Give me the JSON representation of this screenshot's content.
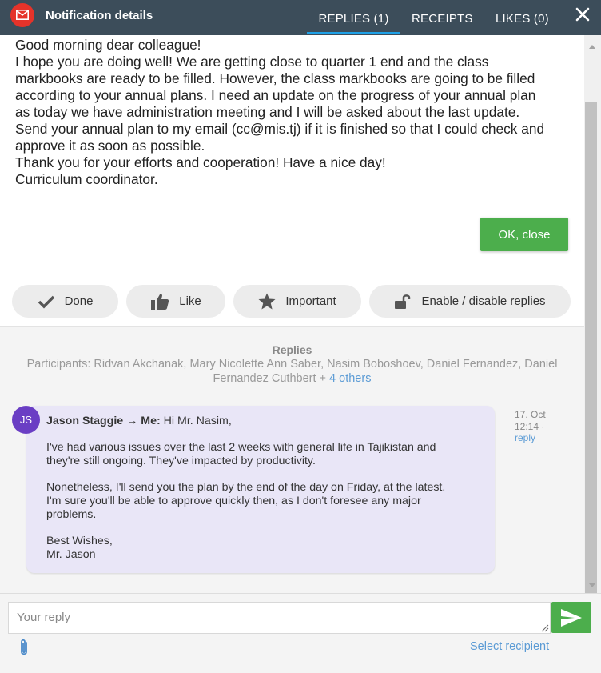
{
  "header": {
    "title": "Notification details",
    "tabs": [
      {
        "label": "REPLIES (1)",
        "active": true
      },
      {
        "label": "RECEIPTS",
        "active": false
      },
      {
        "label": "LIKES (0)",
        "active": false
      }
    ],
    "app_icon": "mail-icon",
    "close_icon": "close-icon"
  },
  "message": {
    "lines": [
      "Good morning dear colleague!",
      "I hope you are doing well! We are getting close to quarter 1 end and the class",
      "markbooks are ready to be filled. However, the class markbooks are going to be filled",
      "according to your annual plans. I need an update on the progress of your annual plan",
      "as today we have administration meeting and I will be asked about the last update.",
      "Send your annual plan to my email (cc@mis.tj) if it is finished so that I could check and",
      "approve it as soon as possible.",
      "Thank you for your efforts and cooperation! Have a nice day!",
      "Curriculum coordinator."
    ],
    "ok_label": "OK, close"
  },
  "actions": [
    {
      "label": "Done",
      "icon": "check-icon"
    },
    {
      "label": "Like",
      "icon": "thumbs-up-icon"
    },
    {
      "label": "Important",
      "icon": "star-icon"
    },
    {
      "label": "Enable / disable replies",
      "icon": "unlock-icon"
    }
  ],
  "replies": {
    "title": "Replies",
    "participants_prefix": "Participants: Ridvan Akchanak, Mary Nicolette Ann Saber, Nasim Boboshoev, Daniel Fernandez, Daniel",
    "participants_line2": "Fernandez Cuthbert +",
    "others_link": "4 others",
    "items": [
      {
        "avatar_initials": "JS",
        "header": "Jason Staggie → Me:",
        "greeting": "Hi Mr. Nasim,",
        "body_lines_1": [
          "I've had various issues over the last 2 weeks with general life in Tajikistan and",
          "they're still ongoing. They've impacted by productivity."
        ],
        "body_lines_2": [
          "Nonetheless, I'll send you the plan by the end of the day on Friday, at the latest.",
          "I'm sure you'll be able to approve quickly then, as I don't foresee any major",
          "problems."
        ],
        "signoff_lines": [
          "Best Wishes,",
          "Mr. Jason"
        ],
        "date": "17. Oct",
        "time": "12:14 ·",
        "reply_label": "reply"
      }
    ]
  },
  "composer": {
    "placeholder": "Your reply",
    "select_recipient": "Select recipient",
    "send_icon": "send-icon",
    "attach_icon": "paperclip-icon"
  },
  "colors": {
    "header_bg": "#3c4d5a",
    "accent": "#1ea0e6",
    "green": "#4cae4c",
    "avatar": "#6a3ec4",
    "bubble": "#e9e6f7",
    "link": "#5b9bd5"
  }
}
